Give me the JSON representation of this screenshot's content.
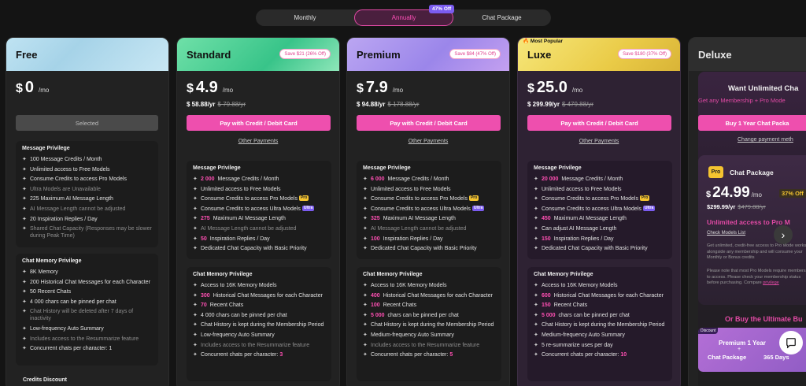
{
  "billing": {
    "monthly": "Monthly",
    "annually": "Annually",
    "chat_package": "Chat Package",
    "badge": "47% Off"
  },
  "plans": {
    "free": {
      "name": "Free",
      "currency": "$",
      "price": "0",
      "per": "/mo",
      "button": "Selected",
      "msg_title": "Message Privilege",
      "msg": [
        "100 Message Credits / Month",
        "Unlimited access to Free Models",
        "Consume Credits to access Pro Models",
        "Ultra Models are Unavailable",
        "225 Maximum AI Message Length",
        "AI Message Length cannot be adjusted",
        "20 Inspiration Replies / Day",
        "Shared Chat Capacity (Responses may be slower during Peak Time)"
      ],
      "mem_title": "Chat Memory Privilege",
      "mem": [
        "8K Memory",
        "200 Historical Chat Messages for each Character",
        "50 Recent Chats",
        "4 000 chars can be pinned per chat",
        "Chat History will be deleted after 7 days of inactivity",
        "Low-frequency Auto Summary",
        "Includes access to the Resummarize feature",
        "Concurrent chats per character: 1"
      ],
      "credits_title": "Credits Discount"
    },
    "standard": {
      "name": "Standard",
      "save": "Save $21 (26% Off)",
      "currency": "$",
      "price": "4.9",
      "per": "/mo",
      "yearly": "$ 58.88/yr",
      "yearly_old": "$ 79.88/yr",
      "button": "Pay with Credit / Debit Card",
      "other": "Other Payments",
      "msg_title": "Message Privilege",
      "msg": {
        "credits_n": "2 000",
        "credits": "Message Credits / Month",
        "free_models": "Unlimited access to Free Models",
        "pro": "Consume Credits to access Pro Models",
        "ultra": "Consume Credits to access Ultra Models",
        "len_n": "275",
        "len": "Maximum AI Message Length",
        "len_adj": "AI Message Length cannot be adjusted",
        "insp_n": "50",
        "insp": "Inspiration Replies / Day",
        "cap": "Dedicated Chat Capacity with Basic Priority"
      },
      "mem_title": "Chat Memory Privilege",
      "mem": {
        "access": "Access to 16K Memory Models",
        "hist_n": "300",
        "hist": "Historical Chat Messages for each Character",
        "recent_n": "70",
        "recent": "Recent Chats",
        "pin": "4 000 chars can be pinned per chat",
        "kept": "Chat History is kept during the Membership Period",
        "summary": "Low-frequency Auto Summary",
        "resum": "Includes access to the Resummarize feature",
        "conc": "Concurrent chats per character:",
        "conc_n": "3"
      }
    },
    "premium": {
      "name": "Premium",
      "save": "Save $84 (47% Off)",
      "currency": "$",
      "price": "7.9",
      "per": "/mo",
      "yearly": "$ 94.88/yr",
      "yearly_old": "$ 178.88/yr",
      "button": "Pay with Credit / Debit Card",
      "other": "Other Payments",
      "msg_title": "Message Privilege",
      "msg": {
        "credits_n": "6 000",
        "credits": "Message Credits / Month",
        "free_models": "Unlimited access to Free Models",
        "pro": "Consume Credits to access Pro Models",
        "ultra": "Consume Credits to access Ultra Models",
        "len_n": "325",
        "len": "Maximum AI Message Length",
        "len_adj": "AI Message Length cannot be adjusted",
        "insp_n": "100",
        "insp": "Inspiration Replies / Day",
        "cap": "Dedicated Chat Capacity with Basic Priority"
      },
      "mem_title": "Chat Memory Privilege",
      "mem": {
        "access": "Access to 16K Memory Models",
        "hist_n": "400",
        "hist": "Historical Chat Messages for each Character",
        "recent_n": "100",
        "recent": "Recent Chats",
        "pin_n": "5 000",
        "pin": "chars can be pinned per chat",
        "kept": "Chat History is kept during the Membership Period",
        "summary": "Medium-frequency Auto Summary",
        "resum": "Includes access to the Resummarize feature",
        "conc": "Concurrent chats per character:",
        "conc_n": "5"
      }
    },
    "luxe": {
      "name": "Luxe",
      "most_popular": "Most Popular",
      "save": "Save $180 (37% Off)",
      "currency": "$",
      "price": "25.0",
      "per": "/mo",
      "yearly": "$ 299.99/yr",
      "yearly_old": "$ 479.88/yr",
      "button": "Pay with Credit / Debit Card",
      "other": "Other Payments",
      "msg_title": "Message Privilege",
      "msg": {
        "credits_n": "20 000",
        "credits": "Message Credits / Month",
        "free_models": "Unlimited access to Free Models",
        "pro": "Consume Credits to access Pro Models",
        "ultra": "Consume Credits to access Ultra Models",
        "len_n": "450",
        "len": "Maximum AI Message Length",
        "len_adj": "Can adjust AI Message Length",
        "insp_n": "150",
        "insp": "Inspiration Replies / Day",
        "cap": "Dedicated Chat Capacity with Basic Priority"
      },
      "mem_title": "Chat Memory Privilege",
      "mem": {
        "access": "Access to 16K Memory Models",
        "hist_n": "600",
        "hist": "Historical Chat Messages for each Character",
        "recent_n": "150",
        "recent": "Recent Chats",
        "pin_n": "5 000",
        "pin": "chars can be pinned per chat",
        "kept": "Chat History is kept during the Membership Period",
        "summary": "Medium-frequency Auto Summary",
        "resum": "5 re-summarize uses per day",
        "conc": "Concurrent chats per character:",
        "conc_n": "10"
      }
    },
    "deluxe": {
      "name": "Deluxe",
      "want": "Want Unlimited Cha",
      "get": "Get any Membership + Pro Mode",
      "button": "Buy 1 Year Chat Packa",
      "change": "Change payment meth",
      "package": {
        "logo": "Pro",
        "name": "Chat Package",
        "currency": "$",
        "price": "24.99",
        "per": "/mo",
        "off": "37% Off",
        "yearly": "$299.99/yr",
        "yearly_old": "$479.88/yr",
        "unlimited": "Unlimited access to Pro M",
        "models_link": "Check Models List",
        "desc1": "Get unlimited, credit-free access to Pro Mode works alongside any membership and will consume your Monthly or Bonus credits",
        "desc2": "Please note that most Pro Models require membership to access. Please check your membership status before purchasing. Compare",
        "privilege": "privilege"
      },
      "or_buy": "Or Buy the Ultimate Bu",
      "combo": {
        "discount": "Discount",
        "l1": "Premium  1 Year",
        "plus": "+",
        "l2": "Chat Package",
        "l3": "365 Days"
      }
    }
  },
  "colors": {
    "accent": "#ee4fae",
    "highlight": "#ff4fb3",
    "pro_tag": "#f4c430",
    "ultra_tag": "#7b5cf0"
  },
  "icons": {
    "next": "chevron-right-icon",
    "chat": "chat-bubble-icon"
  }
}
